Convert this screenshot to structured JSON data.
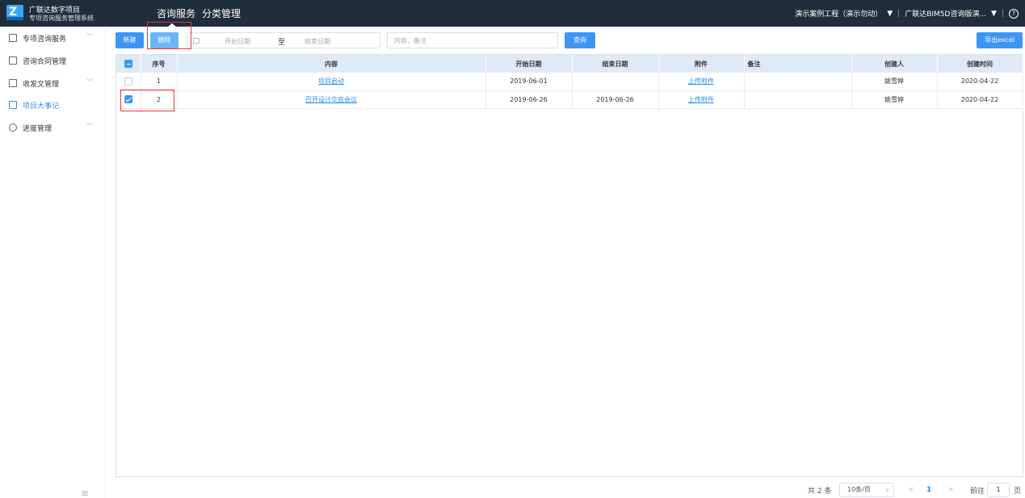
{
  "header": {
    "brand_line1": "广联达数字项目",
    "brand_line2": "专项咨询服务管理系统",
    "tabs": [
      "咨询服务",
      "分类管理"
    ],
    "project": "演示案例工程（演示勿动）",
    "company": "广联达BIM5D咨询版演...",
    "separator": "|",
    "dropdown_glyph": "▼",
    "help": "?"
  },
  "sidebar": {
    "items": [
      {
        "label": "专项咨询服务",
        "icon": "doc-icon",
        "expandable": true
      },
      {
        "label": "咨询合同管理",
        "icon": "contract-icon",
        "expandable": false
      },
      {
        "label": "收发文管理",
        "icon": "mail-icon",
        "expandable": true
      },
      {
        "label": "项目大事记",
        "icon": "notebook-icon",
        "expandable": false,
        "active": true
      },
      {
        "label": "进度管理",
        "icon": "clock-icon",
        "expandable": true
      }
    ],
    "chevron": "﹀",
    "collapse_glyph": "≡"
  },
  "toolbar": {
    "new_label": "新建",
    "delete_label": "删除",
    "start_placeholder": "开始日期",
    "range_sep": "至",
    "end_placeholder": "结束日期",
    "search_placeholder": "内容、备注",
    "search_value": "",
    "query_label": "查询",
    "export_label": "导出excel"
  },
  "table": {
    "columns": [
      "序号",
      "内容",
      "开始日期",
      "结束日期",
      "附件",
      "备注",
      "创建人",
      "创建时间"
    ],
    "rows": [
      {
        "checked": false,
        "no": "1",
        "content": "项目启动",
        "start": "2019-06-01",
        "end": "",
        "attachment": "上传附件",
        "note": "",
        "creator": "姚雪婷",
        "created": "2020-04-22"
      },
      {
        "checked": true,
        "no": "2",
        "content": "召开设计交底会议",
        "start": "2019-06-26",
        "end": "2019-06-26",
        "attachment": "上传附件",
        "note": "",
        "creator": "姚雪婷",
        "created": "2020-04-22"
      }
    ]
  },
  "pagination": {
    "total": "共 2 条",
    "page_size": "10条/页",
    "size_caret": "∨",
    "prev": "<",
    "current": "1",
    "next": ">",
    "goto_label": "前往",
    "goto_value": "1",
    "page_suffix": "页"
  },
  "colors": {
    "topbar": "#1f2d3d",
    "accent": "#3d95f5",
    "header_row": "#deeaf6",
    "highlight": "#e53935"
  }
}
